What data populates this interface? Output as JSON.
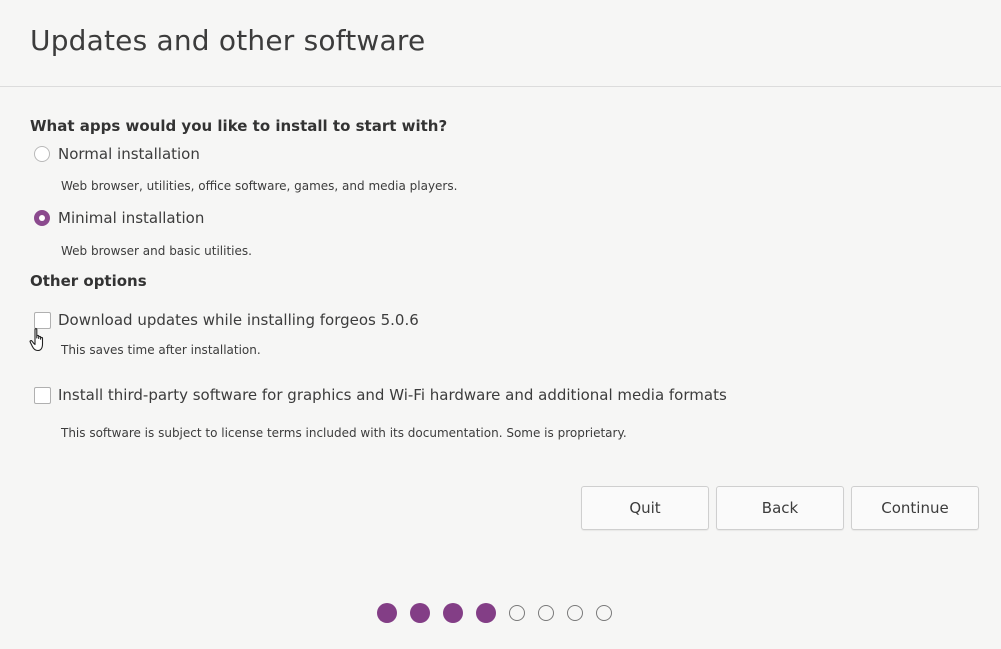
{
  "header": {
    "title": "Updates and other software"
  },
  "apps_section": {
    "heading": "What apps would you like to install to start with?",
    "options": [
      {
        "label": "Normal installation",
        "description": "Web browser, utilities, office software, games, and media players.",
        "selected": false
      },
      {
        "label": "Minimal installation",
        "description": "Web browser and basic utilities.",
        "selected": true
      }
    ]
  },
  "other_section": {
    "heading": "Other options",
    "options": [
      {
        "label": "Download updates while installing forgeos 5.0.6",
        "description": "This saves time after installation.",
        "checked": false
      },
      {
        "label": "Install third-party software for graphics and Wi-Fi hardware and additional media formats",
        "description": "This software is subject to license terms included with its documentation. Some is proprietary.",
        "checked": false
      }
    ]
  },
  "buttons": {
    "quit": "Quit",
    "back": "Back",
    "continue": "Continue"
  },
  "progress": {
    "completed_steps": 4,
    "total_steps": 8
  },
  "colors": {
    "accent": "#833e86",
    "background": "#f6f6f5",
    "text": "#3c3c3c"
  },
  "icons": {
    "cursor": "hand-pointer-icon"
  }
}
